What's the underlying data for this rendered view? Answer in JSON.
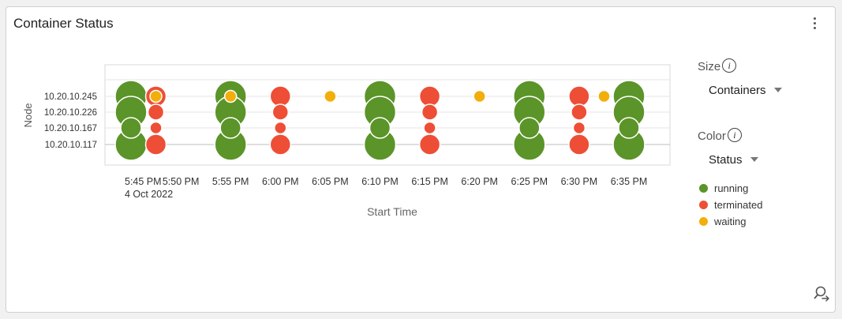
{
  "card": {
    "title": "Container Status"
  },
  "controls": {
    "size_label": "Size",
    "size_value": "Containers",
    "color_label": "Color",
    "color_value": "Status",
    "info_glyph": "i"
  },
  "legend": [
    {
      "label": "running",
      "color": "#5b9428"
    },
    {
      "label": "terminated",
      "color": "#ee4e36"
    },
    {
      "label": "waiting",
      "color": "#f2ae0b"
    }
  ],
  "chart_data": {
    "type": "scatter",
    "title": "",
    "xlabel": "Start Time",
    "ylabel": "Node",
    "categories_y": [
      "10.20.10.245",
      "10.20.10.226",
      "10.20.10.167",
      "10.20.10.117"
    ],
    "x_ticks": [
      "5:45 PM",
      "5:50 PM",
      "5:55 PM",
      "6:00 PM",
      "6:05 PM",
      "6:10 PM",
      "6:15 PM",
      "6:20 PM",
      "6:25 PM",
      "6:30 PM",
      "6:35 PM"
    ],
    "x_date_note": "4 Oct 2022",
    "xlim": [
      "5:41 PM",
      "6:38 PM"
    ],
    "grid": true,
    "points": [
      {
        "time": "5:45 PM",
        "node": "10.20.10.245",
        "status": "running",
        "containers": 3
      },
      {
        "time": "5:45 PM",
        "node": "10.20.10.226",
        "status": "running",
        "containers": 3
      },
      {
        "time": "5:45 PM",
        "node": "10.20.10.167",
        "status": "running",
        "containers": 2
      },
      {
        "time": "5:45 PM",
        "node": "10.20.10.117",
        "status": "running",
        "containers": 3
      },
      {
        "time": "5:47.5 PM",
        "node": "10.20.10.245",
        "status": "terminated",
        "containers": 2
      },
      {
        "time": "5:47.5 PM",
        "node": "10.20.10.245",
        "status": "waiting",
        "containers": 1
      },
      {
        "time": "5:47.5 PM",
        "node": "10.20.10.226",
        "status": "terminated",
        "containers": 1.5
      },
      {
        "time": "5:47.5 PM",
        "node": "10.20.10.167",
        "status": "terminated",
        "containers": 1
      },
      {
        "time": "5:47.5 PM",
        "node": "10.20.10.117",
        "status": "terminated",
        "containers": 2
      },
      {
        "time": "5:55 PM",
        "node": "10.20.10.245",
        "status": "running",
        "containers": 3
      },
      {
        "time": "5:55 PM",
        "node": "10.20.10.245",
        "status": "waiting",
        "containers": 1
      },
      {
        "time": "5:55 PM",
        "node": "10.20.10.226",
        "status": "running",
        "containers": 3
      },
      {
        "time": "5:55 PM",
        "node": "10.20.10.167",
        "status": "running",
        "containers": 2
      },
      {
        "time": "5:55 PM",
        "node": "10.20.10.117",
        "status": "running",
        "containers": 3
      },
      {
        "time": "6:00 PM",
        "node": "10.20.10.245",
        "status": "terminated",
        "containers": 2
      },
      {
        "time": "6:00 PM",
        "node": "10.20.10.226",
        "status": "terminated",
        "containers": 1.5
      },
      {
        "time": "6:00 PM",
        "node": "10.20.10.167",
        "status": "terminated",
        "containers": 1
      },
      {
        "time": "6:00 PM",
        "node": "10.20.10.117",
        "status": "terminated",
        "containers": 2
      },
      {
        "time": "6:05 PM",
        "node": "10.20.10.245",
        "status": "waiting",
        "containers": 1
      },
      {
        "time": "6:10 PM",
        "node": "10.20.10.245",
        "status": "running",
        "containers": 3
      },
      {
        "time": "6:10 PM",
        "node": "10.20.10.226",
        "status": "running",
        "containers": 3
      },
      {
        "time": "6:10 PM",
        "node": "10.20.10.167",
        "status": "running",
        "containers": 2
      },
      {
        "time": "6:10 PM",
        "node": "10.20.10.117",
        "status": "running",
        "containers": 3
      },
      {
        "time": "6:15 PM",
        "node": "10.20.10.245",
        "status": "terminated",
        "containers": 2
      },
      {
        "time": "6:15 PM",
        "node": "10.20.10.226",
        "status": "terminated",
        "containers": 1.5
      },
      {
        "time": "6:15 PM",
        "node": "10.20.10.167",
        "status": "terminated",
        "containers": 1
      },
      {
        "time": "6:15 PM",
        "node": "10.20.10.117",
        "status": "terminated",
        "containers": 2
      },
      {
        "time": "6:20 PM",
        "node": "10.20.10.245",
        "status": "waiting",
        "containers": 1
      },
      {
        "time": "6:25 PM",
        "node": "10.20.10.245",
        "status": "running",
        "containers": 3
      },
      {
        "time": "6:25 PM",
        "node": "10.20.10.226",
        "status": "running",
        "containers": 3
      },
      {
        "time": "6:25 PM",
        "node": "10.20.10.167",
        "status": "running",
        "containers": 2
      },
      {
        "time": "6:25 PM",
        "node": "10.20.10.117",
        "status": "running",
        "containers": 3
      },
      {
        "time": "6:30 PM",
        "node": "10.20.10.245",
        "status": "terminated",
        "containers": 2
      },
      {
        "time": "6:30 PM",
        "node": "10.20.10.226",
        "status": "terminated",
        "containers": 1.5
      },
      {
        "time": "6:30 PM",
        "node": "10.20.10.167",
        "status": "terminated",
        "containers": 1
      },
      {
        "time": "6:30 PM",
        "node": "10.20.10.117",
        "status": "terminated",
        "containers": 2
      },
      {
        "time": "6:32.5 PM",
        "node": "10.20.10.245",
        "status": "waiting",
        "containers": 1
      },
      {
        "time": "6:35 PM",
        "node": "10.20.10.245",
        "status": "running",
        "containers": 3
      },
      {
        "time": "6:35 PM",
        "node": "10.20.10.226",
        "status": "running",
        "containers": 3
      },
      {
        "time": "6:35 PM",
        "node": "10.20.10.167",
        "status": "running",
        "containers": 2
      },
      {
        "time": "6:35 PM",
        "node": "10.20.10.117",
        "status": "running",
        "containers": 3
      }
    ]
  }
}
